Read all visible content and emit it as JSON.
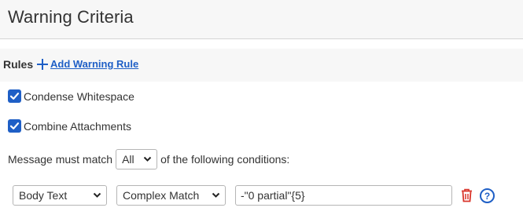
{
  "header": {
    "title": "Warning Criteria"
  },
  "rules": {
    "label": "Rules",
    "add_link": "Add Warning Rule"
  },
  "options": [
    {
      "label": "Condense Whitespace",
      "checked": true
    },
    {
      "label": "Combine Attachments",
      "checked": true
    }
  ],
  "match": {
    "prefix": "Message must match",
    "selected": "All",
    "suffix": "of the following conditions:"
  },
  "condition": {
    "field": "Body Text",
    "operator": "Complex Match",
    "value": "-\"0 partial\"{5}"
  },
  "icons": {
    "add": "plus-icon",
    "checkbox": "checkmark-icon",
    "dropdown": "chevron-down-icon",
    "delete": "trash-icon",
    "help": "help-icon"
  },
  "colors": {
    "accent": "#1f5fc6",
    "delete": "#d9352b",
    "header_bg": "#f7f7f7"
  }
}
